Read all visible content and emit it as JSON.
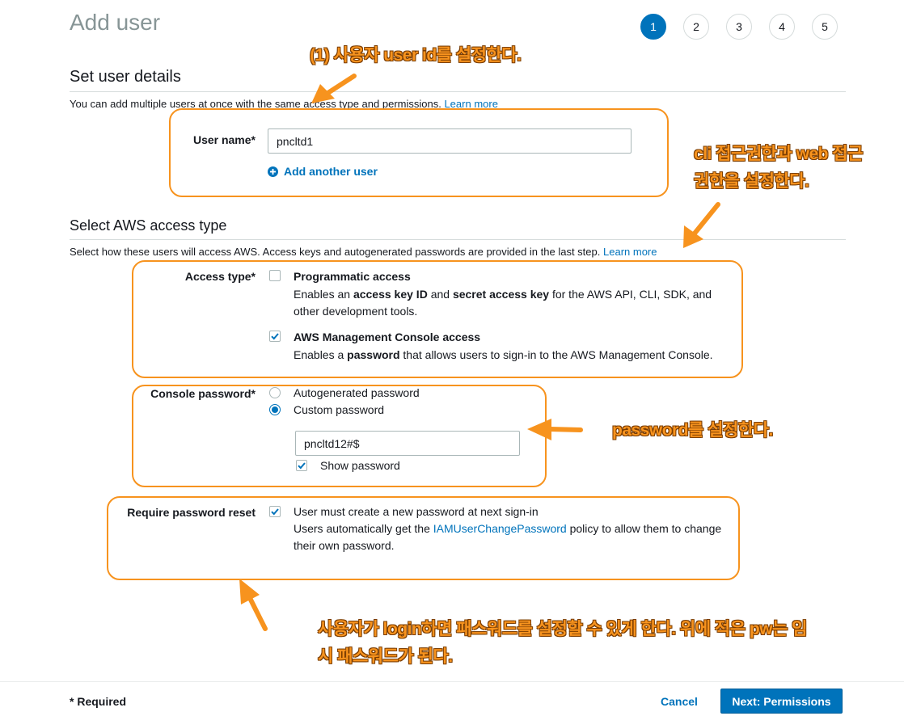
{
  "page": {
    "title": "Add user",
    "steps": [
      "1",
      "2",
      "3",
      "4",
      "5"
    ]
  },
  "user_details": {
    "section_title": "Set user details",
    "description": "You can add multiple users at once with the same access type and permissions.",
    "learn_more": "Learn more",
    "user_name_label": "User name*",
    "user_name_value": "pncltd1",
    "add_another_user": "Add another user"
  },
  "access_type": {
    "section_title": "Select AWS access type",
    "description": "Select how these users will access AWS. Access keys and autogenerated passwords are provided in the last step.",
    "learn_more": "Learn more",
    "label": "Access type*",
    "programmatic": {
      "title": "Programmatic access",
      "checked": false,
      "desc_1": "Enables an ",
      "desc_bold_1": "access key ID",
      "desc_2": " and ",
      "desc_bold_2": "secret access key",
      "desc_3": " for the AWS API, CLI, SDK, and other development tools."
    },
    "console": {
      "title": "AWS Management Console access",
      "checked": true,
      "desc_1": "Enables a ",
      "desc_bold": "password",
      "desc_2": " that allows users to sign-in to the AWS Management Console."
    }
  },
  "console_password": {
    "label": "Console password*",
    "autogenerated": "Autogenerated password",
    "custom": "Custom password",
    "selected": "custom",
    "value": "pncltd12#$",
    "show_password": "Show password",
    "show_password_checked": true
  },
  "password_reset": {
    "label": "Require password reset",
    "checked": true,
    "text": "User must create a new password at next sign-in",
    "desc_1": "Users automatically get the ",
    "policy_link": "IAMUserChangePassword",
    "desc_2": " policy to allow them to change their own password."
  },
  "annotations": {
    "user_id": "(1) 사용자 user id를 설정한다.",
    "access_line_1": "cli 접근권한과 web 접근",
    "access_line_2": "권한을 설정한다.",
    "password": "password를 설정한다.",
    "reset_line_1": "사용자가 login하면 패스워드를 설정할 수 있게 한다. 위에 적은 pw는 임",
    "reset_line_2": "시 패스워드가 된다."
  },
  "footer": {
    "required": "* Required",
    "cancel": "Cancel",
    "next": "Next: Permissions"
  },
  "colors": {
    "accent": "#0073bb",
    "annotation": "#f7931e"
  }
}
